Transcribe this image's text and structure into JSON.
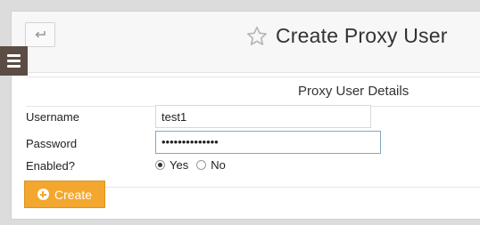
{
  "header": {
    "title": "Create Proxy User",
    "back_icon": "undo-arrow-icon",
    "title_icon": "star-icon"
  },
  "section": {
    "title": "Proxy User Details"
  },
  "form": {
    "username_label": "Username",
    "username_value": "test1",
    "password_label": "Password",
    "password_value": "••••••••••••••",
    "enabled_label": "Enabled?",
    "enabled_options": [
      "Yes",
      "No"
    ],
    "enabled_selected": "Yes"
  },
  "actions": {
    "create_label": "Create"
  },
  "colors": {
    "accent": "#f4a72e",
    "menu_toggle": "#5b4d44"
  }
}
